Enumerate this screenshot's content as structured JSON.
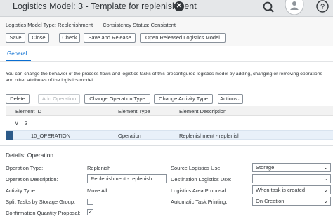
{
  "shell": {
    "title": "Logistics Model: 3 - Template for replenishment",
    "icons": [
      "search-icon",
      "user-icon",
      "help-icon"
    ]
  },
  "header": {
    "model_type_label": "Logistics Model Type:",
    "model_type_value": "Replenishment",
    "consistency_label": "Consistency Status:",
    "consistency_value": "Consistent",
    "buttons": {
      "save": "Save",
      "close": "Close",
      "check": "Check",
      "save_release": "Save and Release",
      "open_released": "Open Released Logistics Model"
    }
  },
  "tabs": {
    "general": "General"
  },
  "main": {
    "description": "You can change the behavior of the process flows and logistics tasks of this preconfigured logistics model by adding, changing or removing operations and other attributes of the logistics model.",
    "toolbar": {
      "delete": "Delete",
      "add_operation": "Add Operation",
      "change_operation_type": "Change Operation Type",
      "change_activity_type": "Change Activity Type",
      "actions": "Actions"
    },
    "table": {
      "columns": [
        "Element ID",
        "Element Type",
        "Element Description"
      ],
      "group_label": "3",
      "rows": [
        {
          "id": "10_OPERATION",
          "type": "Operation",
          "description": "Replenishment - replenish"
        }
      ]
    }
  },
  "details": {
    "title": "Details: Operation",
    "operation_type_label": "Operation Type:",
    "operation_type_value": "Replenish",
    "operation_desc_label": "Operation Description:",
    "operation_desc_value": "Replenishment - replenish",
    "activity_type_label": "Activity Type:",
    "activity_type_value": "Move All",
    "split_tasks_label": "Split Tasks by Storage Group:",
    "split_tasks_checked": false,
    "confirmation_label": "Confirmation Quantity Proposal:",
    "confirmation_checked": true,
    "check_mark": "✓",
    "source_use_label": "Source Logistics Use:",
    "source_use_value": "Storage",
    "dest_use_label": "Destination Logistics Use:",
    "dest_use_value": "",
    "area_proposal_label": "Logistics Area Proposal:",
    "area_proposal_value": "When task is created",
    "auto_print_label": "Automatic Task Printing:",
    "auto_print_value": "On Creation"
  },
  "colors": {
    "accent": "#0a6ed1",
    "selection_marker": "#2b5a89",
    "shell_bg": "#e5e7e9"
  }
}
